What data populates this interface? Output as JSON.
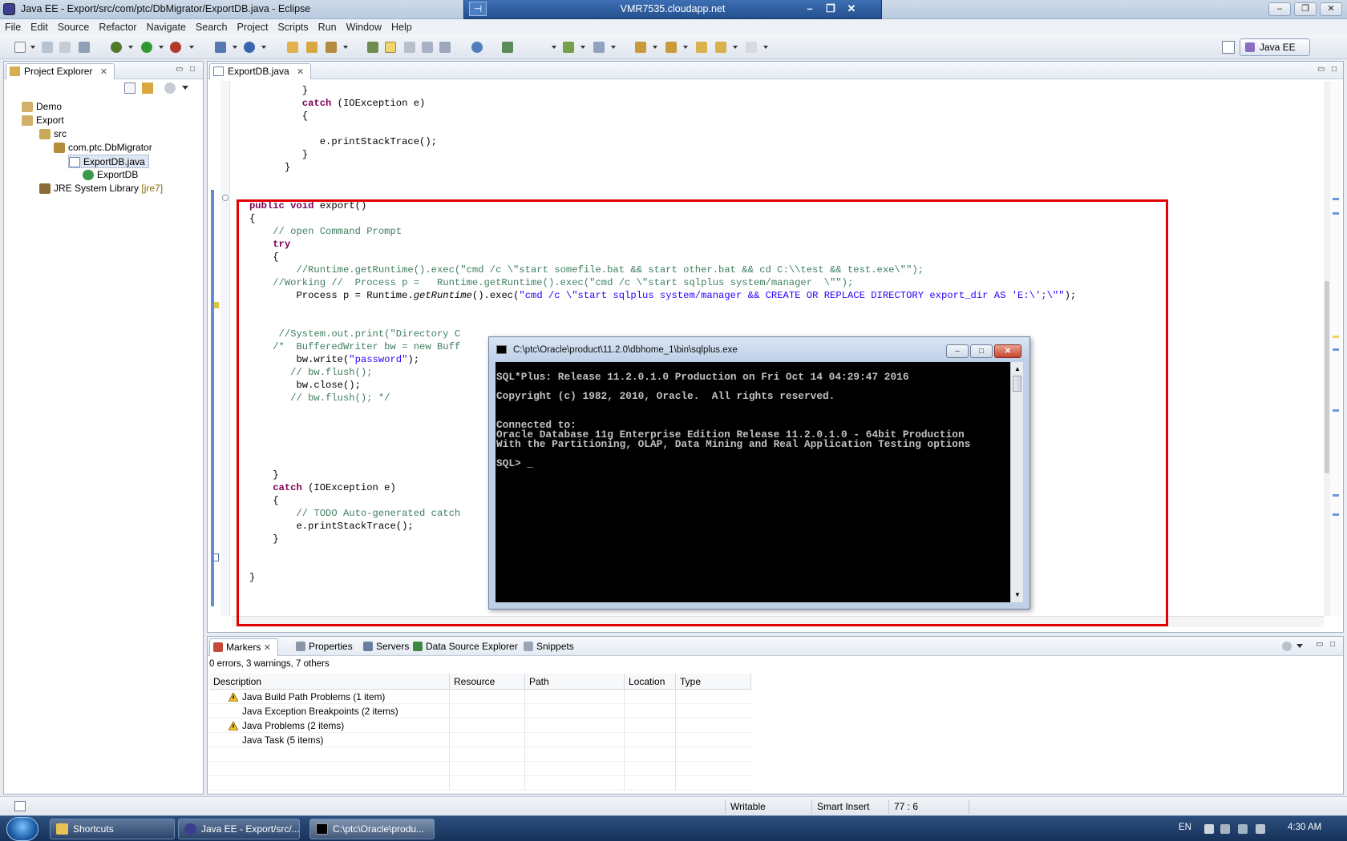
{
  "window": {
    "title": "Java EE - Export/src/com/ptc/DbMigrator/ExportDB.java - Eclipse",
    "remote_host": "VMR7535.cloudapp.net"
  },
  "menu": [
    "File",
    "Edit",
    "Source",
    "Refactor",
    "Navigate",
    "Search",
    "Project",
    "Scripts",
    "Run",
    "Window",
    "Help"
  ],
  "perspective": {
    "label": "Java EE"
  },
  "explorer": {
    "tab_label": "Project Explorer",
    "items": [
      {
        "label": "Demo",
        "depth": 0,
        "icon": "project-icon"
      },
      {
        "label": "Export",
        "depth": 0,
        "icon": "project-icon"
      },
      {
        "label": "src",
        "depth": 1,
        "icon": "source-folder-icon"
      },
      {
        "label": "com.ptc.DbMigrator",
        "depth": 2,
        "icon": "package-icon"
      },
      {
        "label": "ExportDB.java",
        "depth": 3,
        "icon": "java-file-icon",
        "selected": true
      },
      {
        "label": "ExportDB",
        "depth": 4,
        "icon": "class-icon"
      },
      {
        "label": "JRE System Library",
        "decoration": "[jre7]",
        "depth": 1,
        "icon": "library-icon"
      }
    ]
  },
  "editor": {
    "tab_label": "ExportDB.java",
    "lines": [
      "            }",
      "            catch (IOException e)",
      "            {",
      "",
      "               e.printStackTrace();",
      "            }",
      "         }",
      "",
      "",
      "   public void export()",
      "   {",
      "       // open Command Prompt",
      "       try",
      "       {",
      "           //Runtime.getRuntime().exec(\"cmd /c \\\"start somefile.bat && start other.bat && cd C:\\\\test && test.exe\\\"\");",
      "       //Working //  Process p =   Runtime.getRuntime().exec(\"cmd /c \\\"start sqlplus system/manager  \\\"\");",
      "           Process p = Runtime.getRuntime().exec(\"cmd /c \\\"start sqlplus system/manager && CREATE OR REPLACE DIRECTORY export_dir AS 'E:\\';\\\"\");",
      "",
      "",
      "        //System.out.print(\"Directory C",
      "       /*  BufferedWriter bw = new Buff",
      "           bw.write(\"password\");",
      "          // bw.flush();",
      "           bw.close();",
      "          // bw.flush(); */",
      "",
      "",
      "",
      "",
      "",
      "       }",
      "       catch (IOException e)",
      "       {",
      "           // TODO Auto-generated catch",
      "           e.printStackTrace();",
      "       }",
      "",
      "",
      "   }"
    ]
  },
  "console": {
    "title": "C:\\ptc\\Oracle\\product\\11.2.0\\dbhome_1\\bin\\sqlplus.exe",
    "lines": [
      "SQL*Plus: Release 11.2.0.1.0 Production on Fri Oct 14 04:29:47 2016",
      "",
      "Copyright (c) 1982, 2010, Oracle.  All rights reserved.",
      "",
      "",
      "Connected to:",
      "Oracle Database 11g Enterprise Edition Release 11.2.0.1.0 - 64bit Production",
      "With the Partitioning, OLAP, Data Mining and Real Application Testing options",
      "",
      "SQL> _"
    ]
  },
  "bottom_panel": {
    "tabs": [
      "Markers",
      "Properties",
      "Servers",
      "Data Source Explorer",
      "Snippets"
    ],
    "summary": "0 errors, 3 warnings, 7 others",
    "columns": [
      "Description",
      "Resource",
      "Path",
      "Location",
      "Type"
    ],
    "rows": [
      {
        "description": "Java Build Path Problems (1 item)",
        "warning": true
      },
      {
        "description": "Java Exception Breakpoints (2 items)",
        "warning": false
      },
      {
        "description": "Java Problems (2 items)",
        "warning": true
      },
      {
        "description": "Java Task (5 items)",
        "warning": false
      }
    ]
  },
  "statusbar": {
    "mode": "Writable",
    "insert": "Smart Insert",
    "position": "77 : 6"
  },
  "taskbar": {
    "items": [
      "Shortcuts",
      "Java EE - Export/src/...",
      "C:\\ptc\\Oracle\\produ..."
    ],
    "lang": "EN",
    "time": "4:30 AM"
  },
  "colors": {
    "keyword": "#7f0055",
    "comment": "#3f7f5f",
    "string": "#2a00ff",
    "highlight_box": "#e20000",
    "console_bg": "#000000"
  }
}
